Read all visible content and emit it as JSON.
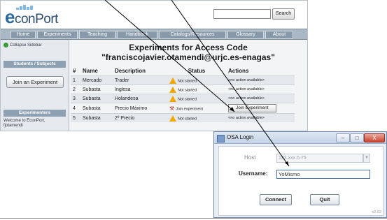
{
  "site": {
    "logo_prefix": "e",
    "logo_text": "conPort",
    "search_label": "Search"
  },
  "nav": [
    "Home",
    "Experiments",
    "Teaching",
    "Handbook",
    "Catalogs/Resources",
    "Glossary",
    "About"
  ],
  "sidebar": {
    "collapse_label": "Collapse Sidebar",
    "section1": "Students / Subjects",
    "join_label": "Join an Experiment",
    "section2": "Experimenters",
    "welcome_line1": "Welcome to EconPort,",
    "welcome_line2": "fjotamendi"
  },
  "main": {
    "title_line1": "Experiments for Access Code",
    "title_line2": "\"franciscojavier.otamendi@urjc.es-enagas\"",
    "columns": [
      "#",
      "Name",
      "Description",
      "Status",
      "Actions"
    ],
    "rows": [
      {
        "num": "1",
        "name": "Mercado",
        "desc": "Trader",
        "status": "Not started",
        "status_icon": "warning-icon",
        "action": "<no action available>"
      },
      {
        "num": "2",
        "name": "Subasta",
        "desc": "Inglesa",
        "status": "Not started",
        "status_icon": "warning-icon",
        "action": "<no action available>"
      },
      {
        "num": "3",
        "name": "Subasta",
        "desc": "Holandesa",
        "status": "Not started",
        "status_icon": "warning-icon",
        "action": "<no action available>"
      },
      {
        "num": "4",
        "name": "Subasta",
        "desc": "Precio Máximo",
        "status": "Join experiment",
        "status_icon": "gavel-icon",
        "action": "Join Experiment"
      },
      {
        "num": "5",
        "name": "Subasta",
        "desc": "2º Precio",
        "status": "Not started",
        "status_icon": "warning-icon",
        "action": "<no action available>"
      }
    ]
  },
  "dialog": {
    "title": "OSA Login",
    "host_label": "Host",
    "host_value": "193.xxx.5.75",
    "username_label": "Username:",
    "username_value": "YoMismo",
    "connect_label": "Connect",
    "quit_label": "Quit",
    "version": "v2.02",
    "window_buttons": {
      "minimize": "–",
      "maximize": "□",
      "close": "X"
    }
  },
  "colors": {
    "nav_bg": "#a9b8c4",
    "warning": "#f0a800",
    "accent": "#2a6aa0"
  }
}
